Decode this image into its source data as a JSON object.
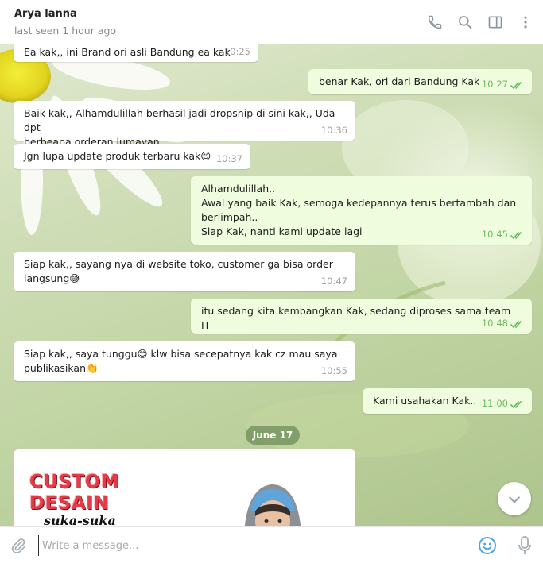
{
  "header": {
    "name": "Arya lanna",
    "status": "last seen 1 hour ago",
    "icons": [
      "phone-icon",
      "search-icon",
      "sidebar-icon",
      "more-vertical-icon"
    ]
  },
  "messages": [
    {
      "dir": "in",
      "text": "Ea kak,,  ini Brand ori asli Bandung ea kak",
      "time": "10:25"
    },
    {
      "dir": "out",
      "text": "benar Kak, ori dari Bandung Kak",
      "time": "10:27",
      "read": true
    },
    {
      "dir": "in",
      "text": "Baik kak,, Alhamdulillah berhasil jadi dropship di sini kak,, Uda dpt\nberbeapa  orderan lumayan ,,",
      "time": "10:36"
    },
    {
      "dir": "in",
      "text": "Jgn lupa update produk terbaru kak😊",
      "time": "10:37"
    },
    {
      "dir": "out",
      "text": "Alhamdulillah..\nAwal yang baik Kak, semoga kedepannya terus bertambah dan\nberlimpah..\nSiap Kak, nanti kami update lagi",
      "time": "10:45",
      "read": true
    },
    {
      "dir": "in",
      "text": "Siap kak,, sayang nya di website toko, customer ga bisa order\nlangsung😅",
      "time": "10:47"
    },
    {
      "dir": "out",
      "text": "itu sedang kita kembangkan Kak, sedang diproses sama team IT",
      "time": "10:48",
      "read": true
    },
    {
      "dir": "in",
      "text": "Siap kak,, saya tunggu😊 klw bisa secepatnya kak cz mau saya\npublikasikan👏",
      "time": "10:55"
    },
    {
      "dir": "out",
      "text": "Kami usahakan Kak..",
      "time": "11:00",
      "read": true
    }
  ],
  "date_separator": "June 17",
  "image_card": {
    "line1": "CUSTOM",
    "line2": "DESAIN",
    "line3": "suka-suka"
  },
  "composer": {
    "placeholder": "Write a message...",
    "icons": [
      "paperclip-icon",
      "smiley-icon",
      "microphone-icon"
    ]
  },
  "colors": {
    "incoming_bubble": "#ffffff",
    "outgoing_bubble": "#effdde",
    "outgoing_time": "#6cbc5c",
    "brand_red": "#e53a47"
  }
}
